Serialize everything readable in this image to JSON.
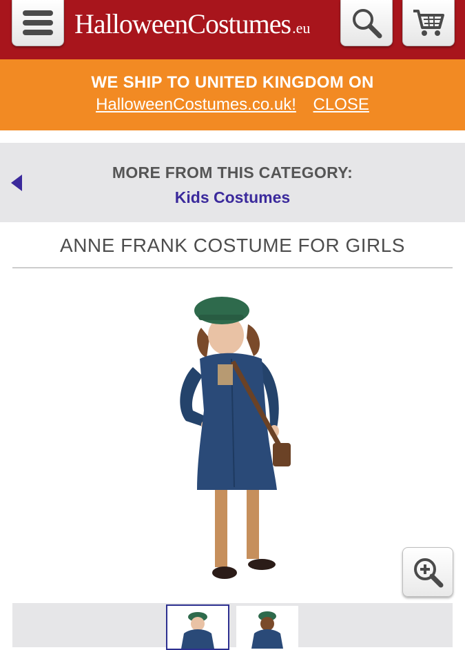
{
  "header": {
    "logo_text": "HalloweenCostumes",
    "logo_tld": ".eu",
    "menu_icon": "hamburger-menu-icon",
    "search_icon": "magnifier-icon",
    "cart_icon": "shopping-cart-icon",
    "background_color": "#a8151c"
  },
  "shipping_banner": {
    "message": "WE SHIP TO UNITED KINGDOM ON",
    "site_link": "HalloweenCostumes.co.uk!",
    "close_label": "CLOSE",
    "background_color": "#f28a23"
  },
  "category": {
    "label": "MORE FROM THIS CATEGORY:",
    "link": "Kids Costumes",
    "back_icon": "left-arrow-icon",
    "link_color": "#3b2a9c"
  },
  "product": {
    "title": "ANNE FRANK COSTUME FOR GIRLS",
    "zoom_icon": "zoom-in-icon",
    "thumbnail_count": 2,
    "selected_thumbnail": 1
  }
}
